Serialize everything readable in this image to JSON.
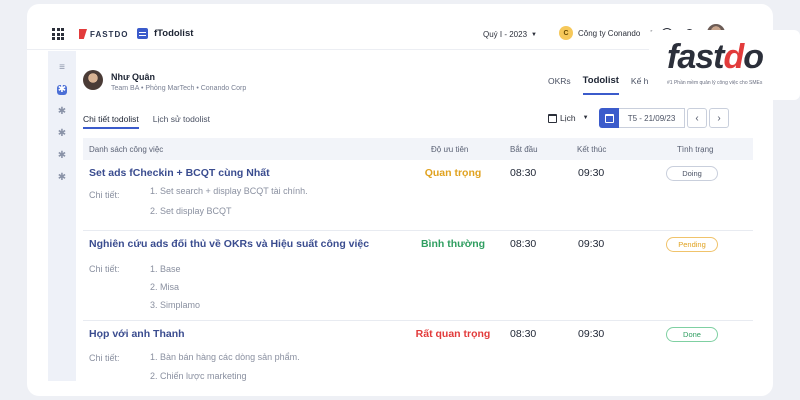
{
  "topbar": {
    "brand": "FASTDO",
    "app_name": "fTodolist",
    "quarter": "Quý I - 2023",
    "company_initial": "C",
    "company": "Công ty Conando"
  },
  "user": {
    "name": "Như Quân",
    "meta": "Team BA • Phòng MarTech • Conando Corp"
  },
  "top_tabs": [
    "OKRs",
    "Todolist",
    "Kế h"
  ],
  "sub_tabs": [
    "Chi tiết todolist",
    "Lịch sử todolist"
  ],
  "view_select": "Lịch",
  "date_range": "T5 - 21/09/23",
  "nav": {
    "prev": "‹",
    "next": "›"
  },
  "table": {
    "headers": [
      "Danh sách công việc",
      "Độ ưu tiên",
      "Bắt đầu",
      "Kết thúc",
      "Tình trạng"
    ],
    "detail_label": "Chi tiết:",
    "rows": [
      {
        "title": "Set ads fCheckin + BCQT cùng Nhất",
        "priority": "Quan trọng",
        "start": "08:30",
        "end": "09:30",
        "status": "Doing",
        "details": [
          "1. Set search + display BCQT tài chính.",
          "2. Set display BCQT"
        ]
      },
      {
        "title": "Nghiên cứu ads đối thủ về OKRs và Hiệu suất công việc",
        "priority": "Bình thường",
        "start": "08:30",
        "end": "09:30",
        "status": "Pending",
        "details": [
          "1. Base",
          "2. Misa",
          "3. Simplamo"
        ]
      },
      {
        "title": "Họp với anh Thanh",
        "priority": "Rất quan trọng",
        "start": "08:30",
        "end": "09:30",
        "status": "Done",
        "details": [
          "1. Bàn bán hàng các dòng sản phẩm.",
          "2. Chiến lược marketing"
        ]
      }
    ]
  },
  "colors": {
    "accent": "#3b5bcb",
    "priority_important": "#e0a21f",
    "priority_normal": "#2f9e60",
    "priority_very_important": "#e23b3b"
  },
  "logo": {
    "word_start": "fast",
    "word_mid": "d",
    "word_end": "o",
    "tagline": "#1 Phần mềm quản lý công việc cho SMEs"
  }
}
